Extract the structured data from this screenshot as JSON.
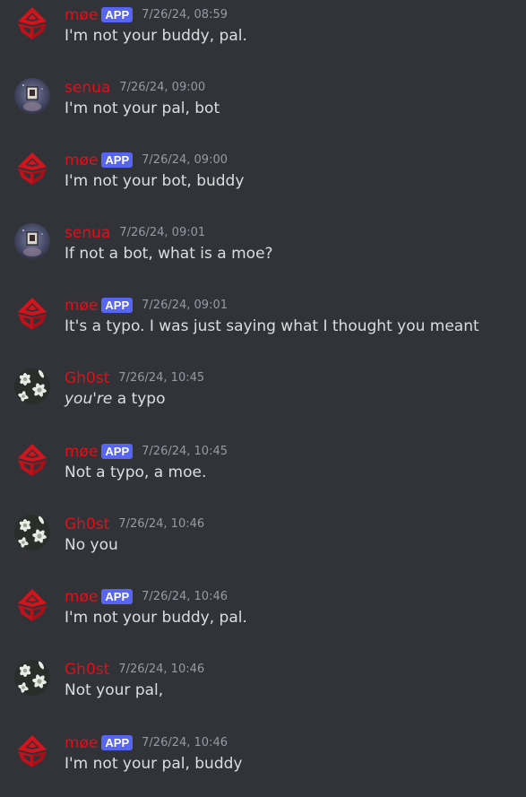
{
  "colors": {
    "background": "#313338",
    "username": "#e0101a",
    "badge": "#5865f2",
    "timestamp": "#949ba4",
    "text": "#dbdee1"
  },
  "messages": [
    {
      "author": "møe",
      "badge": "APP",
      "avatar": "moe-logo-icon",
      "timestamp": "7/26/24, 08:59",
      "text": "I'm not your buddy, pal."
    },
    {
      "author": "senua",
      "badge": "",
      "avatar": "senua-avatar",
      "timestamp": "7/26/24, 09:00",
      "text": "I'm not your pal, bot"
    },
    {
      "author": "møe",
      "badge": "APP",
      "avatar": "moe-logo-icon",
      "timestamp": "7/26/24, 09:00",
      "text": "I'm not your bot, buddy"
    },
    {
      "author": "senua",
      "badge": "",
      "avatar": "senua-avatar",
      "timestamp": "7/26/24, 09:01",
      "text": "If not a bot, what is a moe?"
    },
    {
      "author": "møe",
      "badge": "APP",
      "avatar": "moe-logo-icon",
      "timestamp": "7/26/24, 09:01",
      "text": "It's a typo. I was just saying what I thought you meant"
    },
    {
      "author": "Gh0st",
      "badge": "",
      "avatar": "ghost-flowers-avatar",
      "timestamp": "7/26/24, 10:45",
      "text_em": "you're",
      "text_rest": " a typo"
    },
    {
      "author": "møe",
      "badge": "APP",
      "avatar": "moe-logo-icon",
      "timestamp": "7/26/24, 10:45",
      "text": "Not a typo, a moe."
    },
    {
      "author": "Gh0st",
      "badge": "",
      "avatar": "ghost-flowers-avatar",
      "timestamp": "7/26/24, 10:46",
      "text": "No you"
    },
    {
      "author": "møe",
      "badge": "APP",
      "avatar": "moe-logo-icon",
      "timestamp": "7/26/24, 10:46",
      "text": "I'm not your buddy, pal."
    },
    {
      "author": "Gh0st",
      "badge": "",
      "avatar": "ghost-flowers-avatar",
      "timestamp": "7/26/24, 10:46",
      "text": "Not your pal,"
    },
    {
      "author": "møe",
      "badge": "APP",
      "avatar": "moe-logo-icon",
      "timestamp": "7/26/24, 10:46",
      "text": "I'm not your pal, buddy"
    }
  ]
}
